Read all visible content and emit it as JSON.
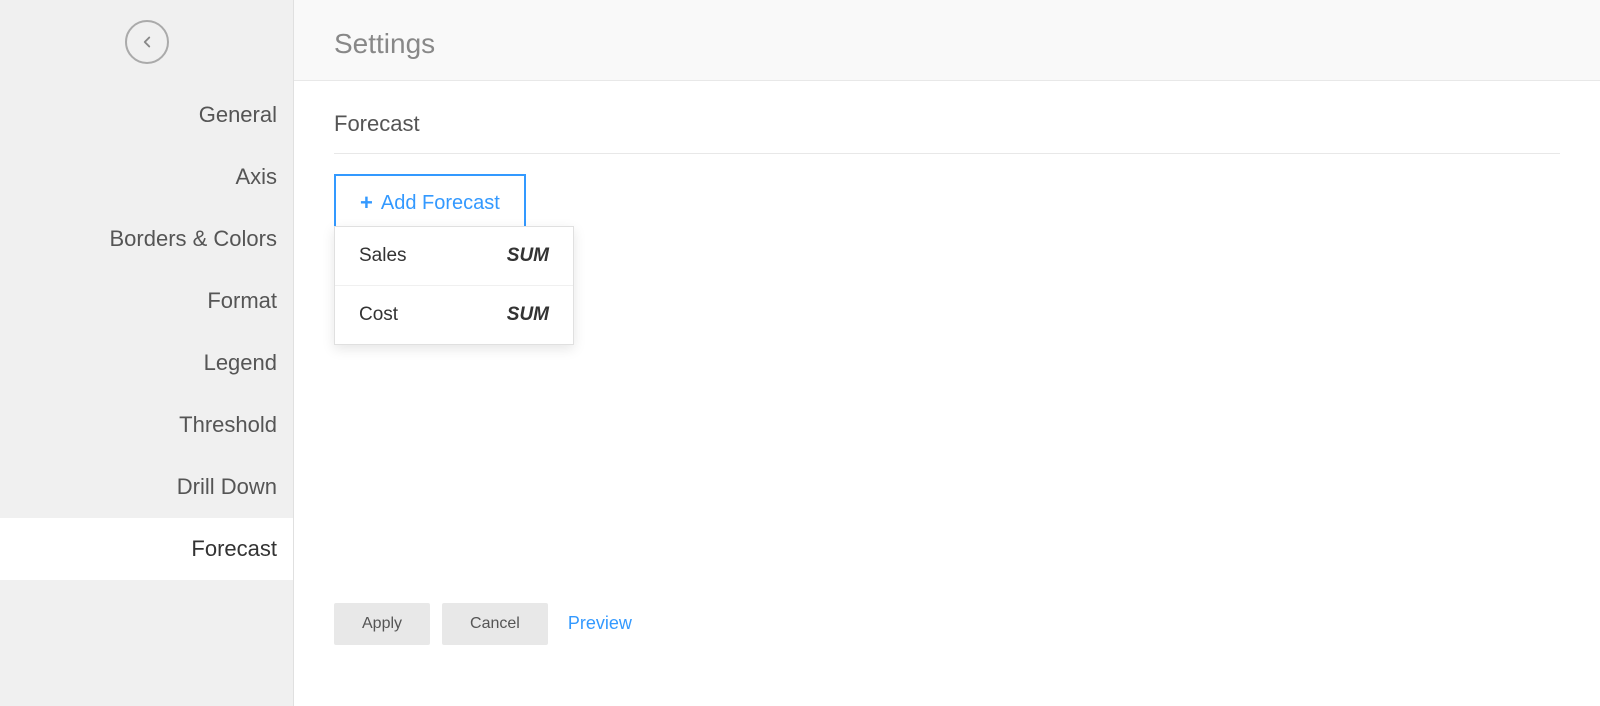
{
  "sidebar": {
    "items": [
      {
        "id": "general",
        "label": "General",
        "active": false
      },
      {
        "id": "axis",
        "label": "Axis",
        "active": false
      },
      {
        "id": "borders-colors",
        "label": "Borders & Colors",
        "active": false
      },
      {
        "id": "format",
        "label": "Format",
        "active": false
      },
      {
        "id": "legend",
        "label": "Legend",
        "active": false
      },
      {
        "id": "threshold",
        "label": "Threshold",
        "active": false
      },
      {
        "id": "drill-down",
        "label": "Drill Down",
        "active": false
      },
      {
        "id": "forecast",
        "label": "Forecast",
        "active": true
      }
    ]
  },
  "header": {
    "title": "Settings"
  },
  "main": {
    "section_title": "Forecast",
    "add_forecast_label": "Add Forecast",
    "plus_symbol": "+",
    "dropdown_items": [
      {
        "name": "Sales",
        "aggregation": "SUM"
      },
      {
        "name": "Cost",
        "aggregation": "SUM"
      }
    ]
  },
  "footer": {
    "apply_label": "Apply",
    "cancel_label": "Cancel",
    "preview_label": "Preview"
  },
  "icons": {
    "back": "chevron-left"
  }
}
